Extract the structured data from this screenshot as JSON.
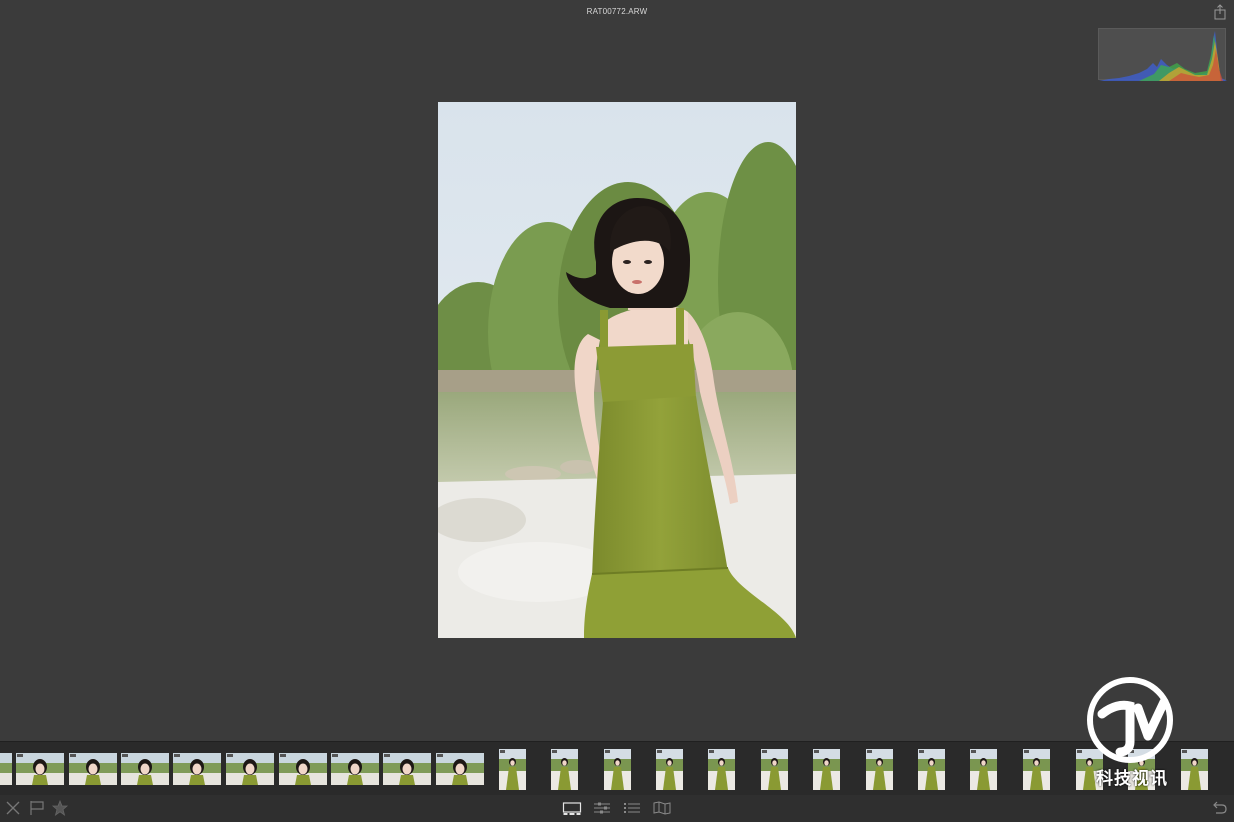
{
  "window": {
    "title": "RAT00772.ARW"
  },
  "icons": {
    "share": "share-icon",
    "reject": "reject-x-icon",
    "flag": "flag-icon",
    "star": "star-icon",
    "view_single": "single-view-icon",
    "view_adjust": "adjust-sliders-icon",
    "view_list": "list-view-icon",
    "view_map": "map-view-icon",
    "undo": "undo-icon"
  },
  "watermark": {
    "text": "科技视讯"
  },
  "colors": {
    "background": "#3b3b3b",
    "filmstrip": "#2a2a2a",
    "toolbar": "#2f2f2f",
    "dress": "#8a9a33"
  }
}
